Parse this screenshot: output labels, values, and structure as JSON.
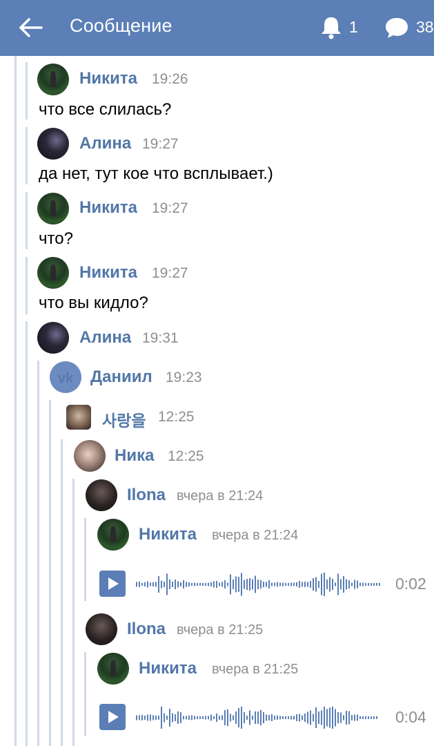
{
  "header": {
    "title": "Сообщение",
    "notifications_count": "1",
    "messages_count": "38"
  },
  "messages": [
    {
      "name": "Никита",
      "time": "19:26",
      "text": "что все слилась?"
    },
    {
      "name": "Алина",
      "time": "19:27",
      "text": "да нет, тут кое что всплывает.)"
    },
    {
      "name": "Никита",
      "time": "19:27",
      "text": "что?"
    },
    {
      "name": "Никита",
      "time": "19:27",
      "text": "что вы кидло?"
    },
    {
      "name": "Алина",
      "time": "19:31"
    }
  ],
  "forwarded": [
    {
      "name": "Даниил",
      "time": "19:23"
    },
    {
      "name": "사랑을",
      "time": "12:25"
    },
    {
      "name": "Ника",
      "time": "12:25"
    },
    {
      "name": "Ilona",
      "time": "вчера в 21:24"
    },
    {
      "name": "Никита",
      "time": "вчера в 21:24"
    },
    {
      "name": "Ilona",
      "time": "вчера в 21:25"
    },
    {
      "name": "Никита",
      "time": "вчера в 21:25"
    }
  ],
  "voice": [
    {
      "duration": "0:02"
    },
    {
      "duration": "0:04"
    }
  ],
  "icons": {
    "back": "arrow-left-icon",
    "bell": "bell-icon",
    "messages": "speech-bubble-icon",
    "play": "play-icon"
  },
  "colors": {
    "header_bg": "#5b7fb6",
    "name": "#5277a8",
    "time": "#8e8e93",
    "thread_line": "#d0d9e8",
    "play_button": "#5a7eb5"
  }
}
